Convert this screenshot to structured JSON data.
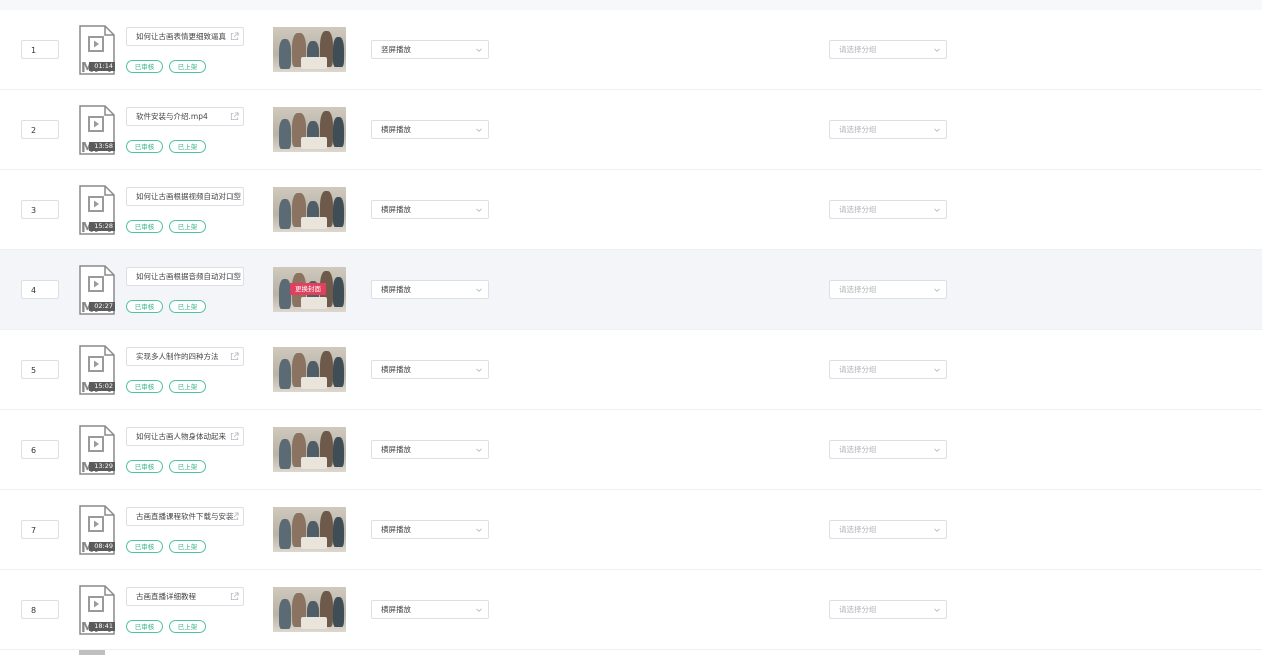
{
  "rows": [
    {
      "order": "1",
      "title": "如何让古画表情更细致逼真",
      "duration": "01:14",
      "status_review": "已审核",
      "status_shelf": "已上架",
      "play_mode": "竖屏播放",
      "group_placeholder": "请选择分组"
    },
    {
      "order": "2",
      "title": "软件安装与介绍.mp4",
      "duration": "13:58",
      "status_review": "已审核",
      "status_shelf": "已上架",
      "play_mode": "横屏播放",
      "group_placeholder": "请选择分组"
    },
    {
      "order": "3",
      "title": "如何让古画根据视频自动对口型",
      "duration": "15:28",
      "status_review": "已审核",
      "status_shelf": "已上架",
      "play_mode": "横屏播放",
      "group_placeholder": "请选择分组"
    },
    {
      "order": "4",
      "title": "如何让古画根据音频自动对口型",
      "duration": "02:27",
      "status_review": "已审核",
      "status_shelf": "已上架",
      "play_mode": "横屏播放",
      "group_placeholder": "请选择分组",
      "cover_button": "更换封面"
    },
    {
      "order": "5",
      "title": "实现多人制作的四种方法",
      "duration": "15:02",
      "status_review": "已审核",
      "status_shelf": "已上架",
      "play_mode": "横屏播放",
      "group_placeholder": "请选择分组"
    },
    {
      "order": "6",
      "title": "如何让古画人物身体动起来",
      "duration": "13:29",
      "status_review": "已审核",
      "status_shelf": "已上架",
      "play_mode": "横屏播放",
      "group_placeholder": "请选择分组"
    },
    {
      "order": "7",
      "title": "古画直播课程软件下载与安装",
      "duration": "08:49",
      "status_review": "已审核",
      "status_shelf": "已上架",
      "play_mode": "横屏播放",
      "group_placeholder": "请选择分组"
    },
    {
      "order": "8",
      "title": "古画直播详细教程",
      "duration": "18:41",
      "status_review": "已审核",
      "status_shelf": "已上架",
      "play_mode": "横屏播放",
      "group_placeholder": "请选择分组"
    }
  ],
  "file_type_label": "MP4",
  "colors": {
    "tag_border": "#52c3a0",
    "cover_button": "#e0405e",
    "row_hover": "#f3f5f8"
  }
}
